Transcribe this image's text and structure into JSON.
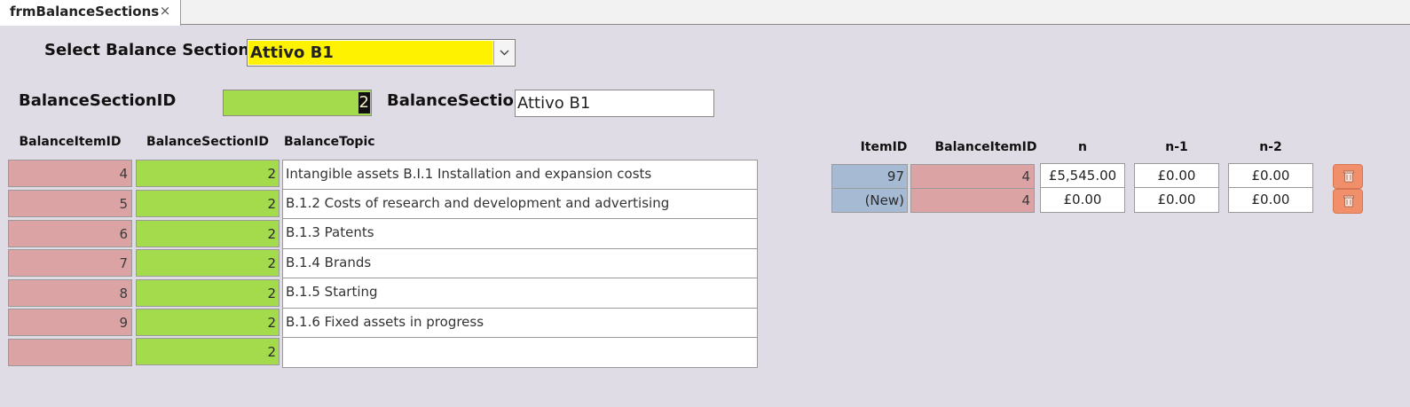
{
  "tab": {
    "title": "frmBalanceSections",
    "close_glyph": "×"
  },
  "selector": {
    "label": "Select Balance Section",
    "value": "Attivo B1"
  },
  "detail": {
    "id_label": "BalanceSectionID",
    "id_value": "2",
    "name_label": "BalanceSection",
    "name_value": "Attivo B1"
  },
  "items": {
    "headers": [
      "BalanceItemID",
      "BalanceSectionID",
      "BalanceTopic"
    ],
    "rows": [
      {
        "item_id": "4",
        "section_id": "2",
        "topic": "Intangible assets B.I.1 Installation and expansion costs"
      },
      {
        "item_id": "5",
        "section_id": "2",
        "topic": "B.1.2 Costs of research and development and advertising"
      },
      {
        "item_id": "6",
        "section_id": "2",
        "topic": "B.1.3 Patents"
      },
      {
        "item_id": "7",
        "section_id": "2",
        "topic": "B.1.4 Brands"
      },
      {
        "item_id": "8",
        "section_id": "2",
        "topic": "B.1.5 Starting"
      },
      {
        "item_id": "9",
        "section_id": "2",
        "topic": "B.1.6 Fixed assets in progress"
      },
      {
        "item_id": "",
        "section_id": "2",
        "topic": ""
      }
    ]
  },
  "values": {
    "headers": [
      "ItemID",
      "BalanceItemID",
      "n",
      "n-1",
      "n-2"
    ],
    "rows": [
      {
        "item_id": "97",
        "balance_item_id": "4",
        "n": "£5,545.00",
        "n1": "£0.00",
        "n2": "£0.00"
      },
      {
        "item_id": "(New)",
        "balance_item_id": "4",
        "n": "£0.00",
        "n1": "£0.00",
        "n2": "£0.00"
      }
    ],
    "delete_icon": "trash-icon"
  },
  "colors": {
    "background": "#e0dce6",
    "combo_highlight": "#fff200",
    "green_field": "#a4db4c",
    "pink_field": "#dba3a4",
    "blue_field": "#a7bad4",
    "delete_button": "#f08f6a"
  }
}
